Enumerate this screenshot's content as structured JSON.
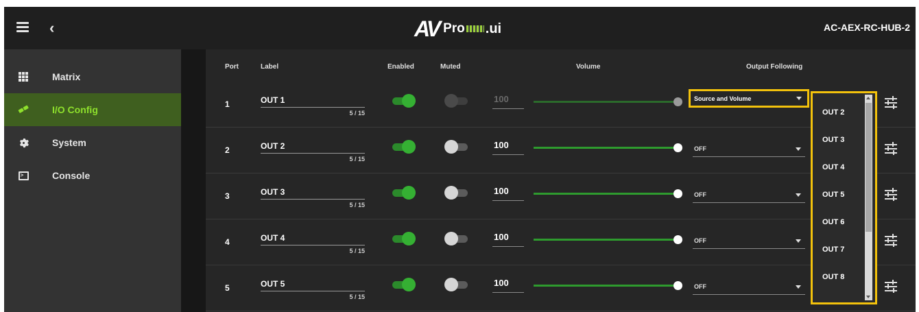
{
  "header": {
    "logo_av": "AV",
    "logo_pro": "Pro",
    "logo_ui": ".ui",
    "device_name": "AC-AEX-RC-HUB-2"
  },
  "sidebar": {
    "items": [
      {
        "label": "Matrix",
        "icon": "grid-icon"
      },
      {
        "label": "I/O Config",
        "icon": "link-icon",
        "active": true
      },
      {
        "label": "System",
        "icon": "gear-icon"
      },
      {
        "label": "Console",
        "icon": "console-icon"
      }
    ]
  },
  "table": {
    "headers": {
      "port": "Port",
      "label": "Label",
      "enabled": "Enabled",
      "muted": "Muted",
      "volume": "Volume",
      "output_following": "Output Following"
    },
    "rows": [
      {
        "port": "1",
        "label": "OUT 1",
        "count": "5 / 15",
        "enabled": true,
        "muted": "disabled",
        "volume": "100",
        "output_following": "Source and Volume"
      },
      {
        "port": "2",
        "label": "OUT 2",
        "count": "5 / 15",
        "enabled": true,
        "muted": false,
        "volume": "100",
        "output_following": "OFF"
      },
      {
        "port": "3",
        "label": "OUT 3",
        "count": "5 / 15",
        "enabled": true,
        "muted": false,
        "volume": "100",
        "output_following": "OFF"
      },
      {
        "port": "4",
        "label": "OUT 4",
        "count": "5 / 15",
        "enabled": true,
        "muted": false,
        "volume": "100",
        "output_following": "OFF"
      },
      {
        "port": "5",
        "label": "OUT 5",
        "count": "5 / 15",
        "enabled": true,
        "muted": false,
        "volume": "100",
        "output_following": "OFF"
      }
    ]
  },
  "dropdown": {
    "options": [
      "OUT 2",
      "OUT 3",
      "OUT 4",
      "OUT 5",
      "OUT 6",
      "OUT 7",
      "OUT 8"
    ]
  },
  "colors": {
    "accent_green": "#35b033",
    "active_nav_text": "#8ee02c",
    "highlight": "#f3c20c"
  }
}
